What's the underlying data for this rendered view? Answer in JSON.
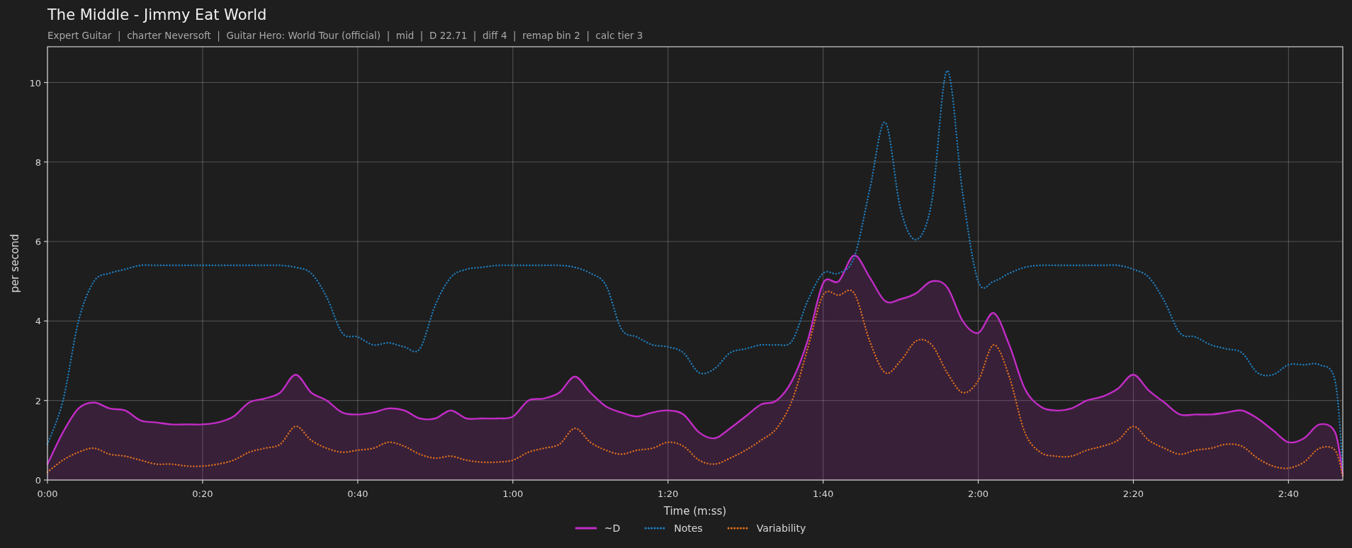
{
  "header": {
    "title": "The Middle - Jimmy Eat World",
    "subtitle": "Expert Guitar  |  charter Neversoft  |  Guitar Hero: World Tour (official)  |  mid  |  D 22.71  |  diff 4  |  remap bin 2  |  calc tier 3"
  },
  "chart": {
    "chart_data": {
      "type": "line",
      "xlabel": "Time (m:ss)",
      "ylabel": "per second",
      "xlim": [
        0,
        167
      ],
      "ylim": [
        0,
        10.9
      ],
      "grid": true,
      "xticks": [
        {
          "value": 0,
          "label": "0:00"
        },
        {
          "value": 20,
          "label": "0:20"
        },
        {
          "value": 40,
          "label": "0:40"
        },
        {
          "value": 60,
          "label": "1:00"
        },
        {
          "value": 80,
          "label": "1:20"
        },
        {
          "value": 100,
          "label": "1:40"
        },
        {
          "value": 120,
          "label": "2:00"
        },
        {
          "value": 140,
          "label": "2:20"
        },
        {
          "value": 160,
          "label": "2:40"
        }
      ],
      "yticks": [
        0,
        2,
        4,
        6,
        8,
        10
      ],
      "x": [
        0,
        2,
        4,
        6,
        8,
        10,
        12,
        14,
        16,
        18,
        20,
        22,
        24,
        26,
        28,
        30,
        32,
        34,
        36,
        38,
        40,
        42,
        44,
        46,
        48,
        50,
        52,
        54,
        56,
        58,
        60,
        62,
        64,
        66,
        68,
        70,
        72,
        74,
        76,
        78,
        80,
        82,
        84,
        86,
        88,
        90,
        92,
        94,
        96,
        98,
        100,
        102,
        104,
        106,
        108,
        110,
        112,
        114,
        116,
        118,
        120,
        122,
        124,
        126,
        128,
        130,
        132,
        134,
        136,
        138,
        140,
        142,
        144,
        146,
        148,
        150,
        152,
        154,
        156,
        158,
        160,
        162,
        164,
        166,
        167
      ],
      "series": [
        {
          "name": "~D",
          "color": "#c22cc6",
          "type": "area",
          "line_style": "solid",
          "values": [
            0.4,
            1.2,
            1.8,
            1.95,
            1.8,
            1.75,
            1.5,
            1.45,
            1.4,
            1.4,
            1.4,
            1.45,
            1.6,
            1.95,
            2.05,
            2.2,
            2.65,
            2.2,
            2.0,
            1.7,
            1.65,
            1.7,
            1.8,
            1.75,
            1.55,
            1.55,
            1.75,
            1.55,
            1.55,
            1.55,
            1.6,
            2.0,
            2.05,
            2.2,
            2.6,
            2.2,
            1.85,
            1.7,
            1.6,
            1.7,
            1.75,
            1.65,
            1.2,
            1.05,
            1.3,
            1.6,
            1.9,
            2.0,
            2.5,
            3.5,
            4.95,
            5.0,
            5.65,
            5.1,
            4.5,
            4.55,
            4.7,
            5.0,
            4.85,
            4.0,
            3.7,
            4.2,
            3.4,
            2.3,
            1.85,
            1.75,
            1.8,
            2.0,
            2.1,
            2.3,
            2.65,
            2.25,
            1.95,
            1.65,
            1.65,
            1.65,
            1.7,
            1.75,
            1.55,
            1.25,
            0.95,
            1.05,
            1.4,
            1.2,
            0.15
          ]
        },
        {
          "name": "Notes",
          "color": "#1f7fc0",
          "type": "line",
          "line_style": "dotted",
          "values": [
            0.9,
            2.0,
            4.0,
            5.0,
            5.2,
            5.3,
            5.4,
            5.4,
            5.4,
            5.4,
            5.4,
            5.4,
            5.4,
            5.4,
            5.4,
            5.4,
            5.35,
            5.2,
            4.6,
            3.7,
            3.6,
            3.4,
            3.45,
            3.35,
            3.3,
            4.4,
            5.1,
            5.3,
            5.35,
            5.4,
            5.4,
            5.4,
            5.4,
            5.4,
            5.35,
            5.2,
            4.9,
            3.8,
            3.6,
            3.4,
            3.35,
            3.2,
            2.7,
            2.8,
            3.2,
            3.3,
            3.4,
            3.4,
            3.5,
            4.5,
            5.2,
            5.2,
            5.6,
            7.3,
            9.0,
            6.8,
            6.05,
            7.0,
            10.3,
            7.2,
            5.0,
            5.0,
            5.2,
            5.35,
            5.4,
            5.4,
            5.4,
            5.4,
            5.4,
            5.4,
            5.3,
            5.1,
            4.5,
            3.7,
            3.6,
            3.4,
            3.3,
            3.2,
            2.7,
            2.65,
            2.9,
            2.9,
            2.9,
            2.5,
            0.3
          ]
        },
        {
          "name": "Variability",
          "color": "#e0701c",
          "type": "line",
          "line_style": "dotted",
          "values": [
            0.2,
            0.5,
            0.7,
            0.8,
            0.65,
            0.6,
            0.5,
            0.4,
            0.4,
            0.35,
            0.35,
            0.4,
            0.5,
            0.7,
            0.8,
            0.9,
            1.35,
            1.0,
            0.8,
            0.7,
            0.75,
            0.8,
            0.95,
            0.85,
            0.65,
            0.55,
            0.6,
            0.5,
            0.45,
            0.45,
            0.5,
            0.7,
            0.8,
            0.9,
            1.3,
            0.95,
            0.75,
            0.65,
            0.75,
            0.8,
            0.95,
            0.85,
            0.5,
            0.4,
            0.55,
            0.75,
            1.0,
            1.3,
            2.0,
            3.3,
            4.65,
            4.65,
            4.7,
            3.5,
            2.7,
            3.0,
            3.5,
            3.4,
            2.7,
            2.2,
            2.5,
            3.4,
            2.6,
            1.2,
            0.7,
            0.6,
            0.6,
            0.75,
            0.85,
            1.0,
            1.35,
            1.0,
            0.8,
            0.65,
            0.75,
            0.8,
            0.9,
            0.85,
            0.55,
            0.35,
            0.3,
            0.45,
            0.8,
            0.75,
            0.1
          ]
        }
      ]
    }
  }
}
